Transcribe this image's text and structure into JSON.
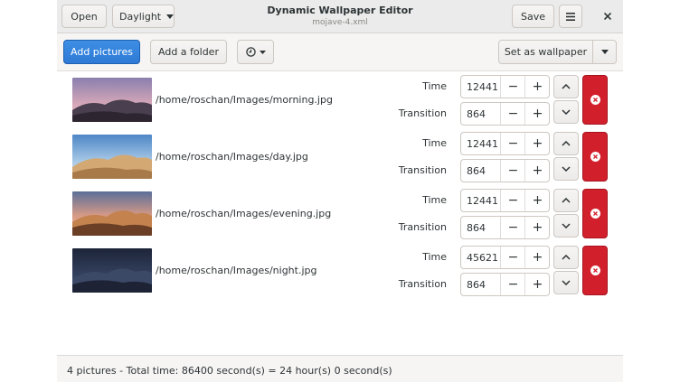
{
  "header": {
    "open_label": "Open",
    "theme_label": "Daylight",
    "title": "Dynamic Wallpaper Editor",
    "subtitle": "mojave-4.xml",
    "save_label": "Save"
  },
  "toolbar": {
    "add_pictures_label": "Add pictures",
    "add_folder_label": "Add a folder",
    "set_wallpaper_label": "Set as wallpaper"
  },
  "rows": [
    {
      "path": "/home/roschan/Images/morning.jpg",
      "time_label": "Time",
      "time": "12441",
      "transition_label": "Transition",
      "transition": "864"
    },
    {
      "path": "/home/roschan/Images/day.jpg",
      "time_label": "Time",
      "time": "12441",
      "transition_label": "Transition",
      "transition": "864"
    },
    {
      "path": "/home/roschan/Images/evening.jpg",
      "time_label": "Time",
      "time": "12441",
      "transition_label": "Transition",
      "transition": "864"
    },
    {
      "path": "/home/roschan/Images/night.jpg",
      "time_label": "Time",
      "time": "45621",
      "transition_label": "Transition",
      "transition": "864"
    }
  ],
  "status": {
    "text": "4 pictures - Total time: 86400 second(s) = 24 hour(s) 0 second(s)"
  },
  "colors": {
    "accent": "#3584e4",
    "delete": "#d21f2c"
  }
}
